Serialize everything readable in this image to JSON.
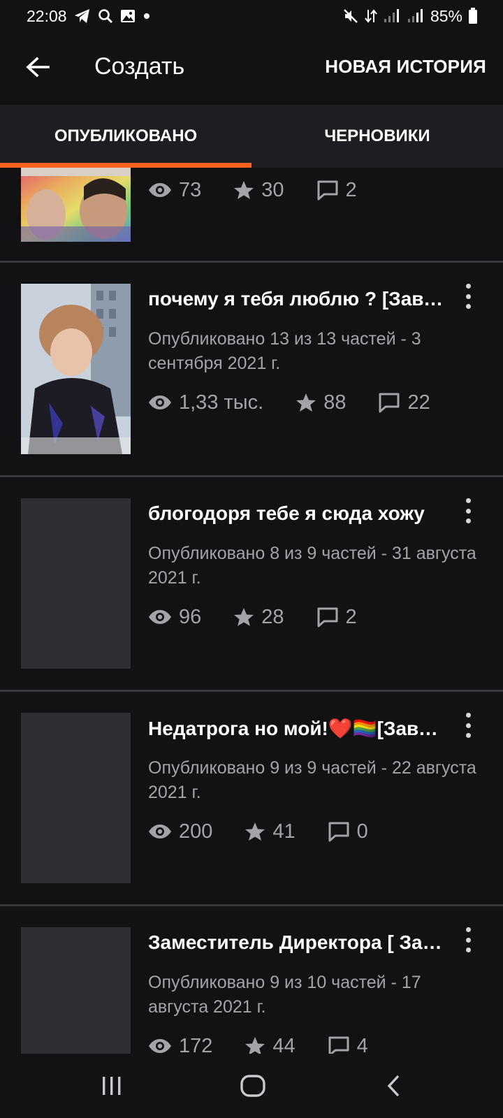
{
  "status_bar": {
    "time": "22:08",
    "battery": "85%"
  },
  "app_bar": {
    "title": "Создать",
    "new_story_label": "НОВАЯ ИСТОРИЯ"
  },
  "tabs": [
    {
      "label": "ОПУБЛИКОВАНО",
      "active": true
    },
    {
      "label": "ЧЕРНОВИКИ",
      "active": false
    }
  ],
  "stories": [
    {
      "title": "",
      "meta": "",
      "views": "73",
      "votes": "30",
      "comments": "2"
    },
    {
      "title": "почему я тебя люблю ? [Завершено]",
      "meta": "Опубликовано 13 из 13 частей - 3 сентября 2021 г.",
      "views": "1,33 тыс.",
      "votes": "88",
      "comments": "22"
    },
    {
      "title": "блогодоря тебе я сюда хожу",
      "meta": "Опубликовано 8 из 9 частей - 31 августа 2021 г.",
      "views": "96",
      "votes": "28",
      "comments": "2"
    },
    {
      "title": "Недатрога но мой!❤️🏳️‍🌈[Завершено]",
      "meta": "Опубликовано 9 из 9 частей - 22 августа 2021 г.",
      "views": "200",
      "votes": "41",
      "comments": "0"
    },
    {
      "title": "Заместитель Директора [ Завершено ]",
      "meta": "Опубликовано 9 из 10 частей - 17 августа 2021 г.",
      "views": "172",
      "votes": "44",
      "comments": "4"
    }
  ],
  "icons": {
    "views": "eye-icon",
    "votes": "star-icon",
    "comments": "comment-icon",
    "more": "more-vertical-icon"
  },
  "colors": {
    "accent": "#ff6122",
    "background": "#121114",
    "tab_bar": "#1e1d21",
    "muted_text": "#a4a3a8",
    "placeholder_cover": "#2f2e33"
  }
}
